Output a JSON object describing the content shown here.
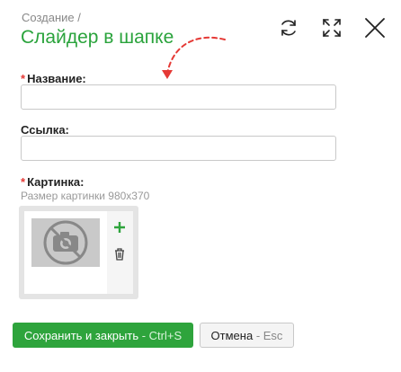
{
  "header": {
    "breadcrumb": "Создание /",
    "title": "Слайдер в шапке",
    "tools": [
      {
        "icon": "refresh-icon"
      },
      {
        "icon": "expand-icon"
      },
      {
        "icon": "close-icon"
      }
    ]
  },
  "form": {
    "name_field": {
      "label": "Название:",
      "required_mark": "*",
      "value": ""
    },
    "link_field": {
      "label": "Ссылка:",
      "value": ""
    },
    "image_field": {
      "label": "Картинка:",
      "required_mark": "*",
      "size_hint": "Размер картинки 980x370",
      "placeholder_icon": "no-camera-icon",
      "add_icon": "plus-icon",
      "delete_icon": "trash-icon"
    }
  },
  "actions": {
    "save_label": "Сохранить и закрыть",
    "save_shortcut": " - Ctrl+S",
    "cancel_label": "Отмена",
    "cancel_shortcut": " - Esc"
  },
  "colors": {
    "accent_green": "#2aa33c",
    "required_red": "#e53935",
    "hint_arrow_red": "#e53935"
  }
}
